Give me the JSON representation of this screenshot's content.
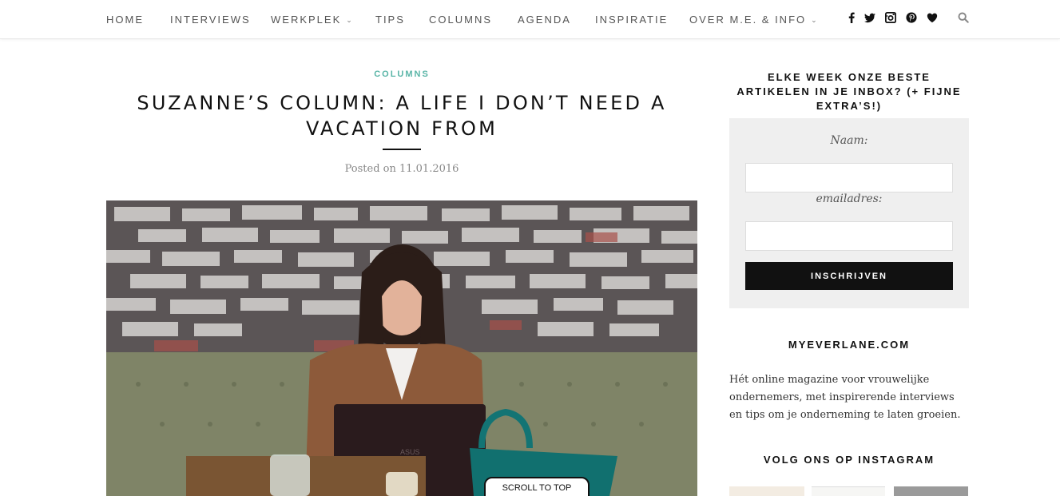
{
  "nav": {
    "items": [
      {
        "label": "HOME",
        "dropdown": false
      },
      {
        "label": "INTERVIEWS",
        "dropdown": false
      },
      {
        "label": "WERKPLEK",
        "dropdown": true
      },
      {
        "label": "TIPS",
        "dropdown": false
      },
      {
        "label": "COLUMNS",
        "dropdown": false
      },
      {
        "label": "AGENDA",
        "dropdown": false
      },
      {
        "label": "INSPIRATIE",
        "dropdown": false
      },
      {
        "label": "OVER M.E. & INFO",
        "dropdown": true
      }
    ],
    "social_icons": [
      "facebook-icon",
      "twitter-icon",
      "instagram-icon",
      "pinterest-icon",
      "heart-icon"
    ],
    "search_icon": "search-icon"
  },
  "article": {
    "category": "COLUMNS",
    "title": "SUZANNE’S COLUMN: A LIFE I DON’T NEED A VACATION FROM",
    "posted": "Posted on 11.01.2016",
    "image_alt": "ASUS"
  },
  "scroll_top": "SCROLL TO TOP",
  "sidebar": {
    "newsletter_heading": "ELKE WEEK ONZE BESTE ARTIKELEN IN JE INBOX? (+ FIJNE EXTRA’S!)",
    "name_label": "Naam:",
    "name_value": "",
    "email_label": "emailadres:",
    "email_value": "",
    "subscribe_button": "INSCHRIJVEN",
    "site_heading": "MYEVERLANE.COM",
    "about_text": "Hét online magazine voor vrouwelijke ondernemers, met inspirerende interviews en tips om je onderneming te laten groeien.",
    "instagram_heading": "VOLG ONS OP INSTAGRAM"
  },
  "colors": {
    "accent": "#5ab5a7",
    "dark": "#111111",
    "panel": "#efefef"
  }
}
